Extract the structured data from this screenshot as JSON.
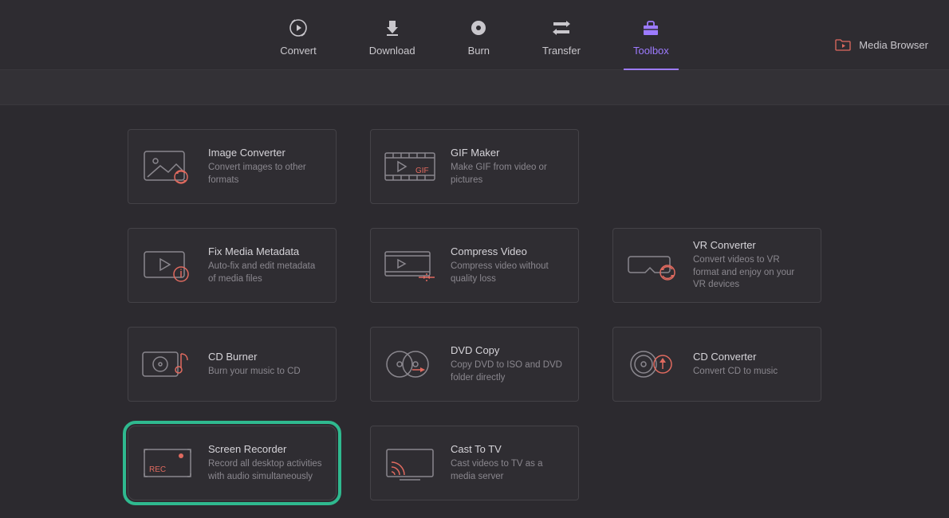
{
  "nav": {
    "items": [
      {
        "label": "Convert"
      },
      {
        "label": "Download"
      },
      {
        "label": "Burn"
      },
      {
        "label": "Transfer"
      },
      {
        "label": "Toolbox"
      }
    ]
  },
  "media_browser_label": "Media Browser",
  "tools": [
    {
      "title": "Image Converter",
      "desc": "Convert images to other formats"
    },
    {
      "title": "GIF Maker",
      "desc": "Make GIF from video or pictures"
    },
    {
      "title": "",
      "desc": ""
    },
    {
      "title": "Fix Media Metadata",
      "desc": "Auto-fix and edit metadata of media files"
    },
    {
      "title": "Compress Video",
      "desc": "Compress video without quality loss"
    },
    {
      "title": "VR Converter",
      "desc": "Convert videos to VR format and enjoy on your VR devices"
    },
    {
      "title": "CD Burner",
      "desc": "Burn your music to CD"
    },
    {
      "title": "DVD Copy",
      "desc": "Copy DVD to ISO and DVD folder directly"
    },
    {
      "title": "CD Converter",
      "desc": "Convert CD to music"
    },
    {
      "title": "Screen Recorder",
      "desc": "Record all desktop activities with audio simultaneously"
    },
    {
      "title": "Cast To TV",
      "desc": "Cast videos to TV as a media server"
    },
    {
      "title": "",
      "desc": ""
    }
  ]
}
